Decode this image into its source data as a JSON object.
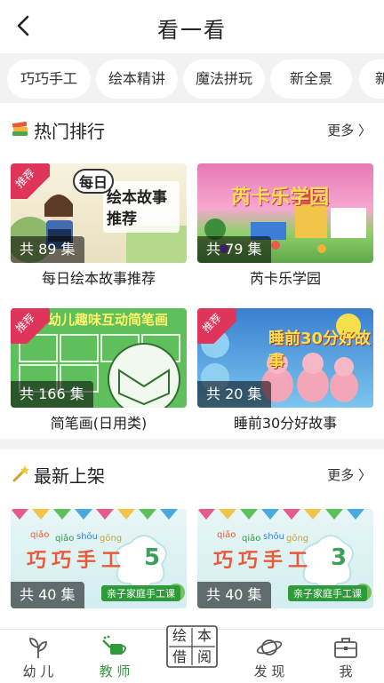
{
  "header": {
    "title": "看一看"
  },
  "tabs": [
    "巧巧手工",
    "绘本精讲",
    "魔法拼玩",
    "新全景",
    "新"
  ],
  "hot": {
    "title": "热门排行",
    "more": "更多",
    "items": [
      {
        "title": "每日绘本故事推荐",
        "count": "共 89 集",
        "badge": "推荐",
        "thumb_text": [
          "每日",
          "绘本故事",
          "推荐"
        ]
      },
      {
        "title": "芮卡乐学园",
        "count": "共 79 集",
        "badge": "推荐",
        "thumb_text": [
          "芮卡乐学园"
        ]
      },
      {
        "title": "简笔画(日用类)",
        "count": "共 166 集",
        "badge": "推荐",
        "thumb_text": [
          "幼儿趣味互动简笔画"
        ]
      },
      {
        "title": "睡前30分好故事",
        "count": "共 20 集",
        "badge": "推荐",
        "thumb_text": [
          "睡前30分好故事"
        ]
      }
    ]
  },
  "latest": {
    "title": "最新上架",
    "more": "更多",
    "items": [
      {
        "count": "共 40 集",
        "thumb_text": [
          "巧巧手工",
          "5",
          "亲子家庭手工课"
        ],
        "pinyin": [
          "qiǎo",
          "qiǎo",
          "shǒu",
          "gōng"
        ]
      },
      {
        "count": "共 40 集",
        "thumb_text": [
          "巧巧手工",
          "3",
          "亲子家庭手工课"
        ],
        "pinyin": [
          "qiǎo",
          "qiǎo",
          "shǒu",
          "gōng"
        ]
      }
    ]
  },
  "bottom_nav": {
    "items": [
      {
        "label": "幼 儿",
        "icon": "leaf-icon"
      },
      {
        "label": "教 师",
        "icon": "watering-can-icon",
        "active": true
      },
      {
        "label": "绘本借阅",
        "chars": [
          "绘",
          "本",
          "借",
          "阅"
        ],
        "icon": "book-badge-icon"
      },
      {
        "label": "发 现",
        "icon": "planet-icon"
      },
      {
        "label": "我",
        "icon": "briefcase-icon"
      }
    ]
  },
  "colors": {
    "accent": "#2f9a3a",
    "badge": "#e0355a",
    "tab_bg": "#f2f2f2"
  }
}
